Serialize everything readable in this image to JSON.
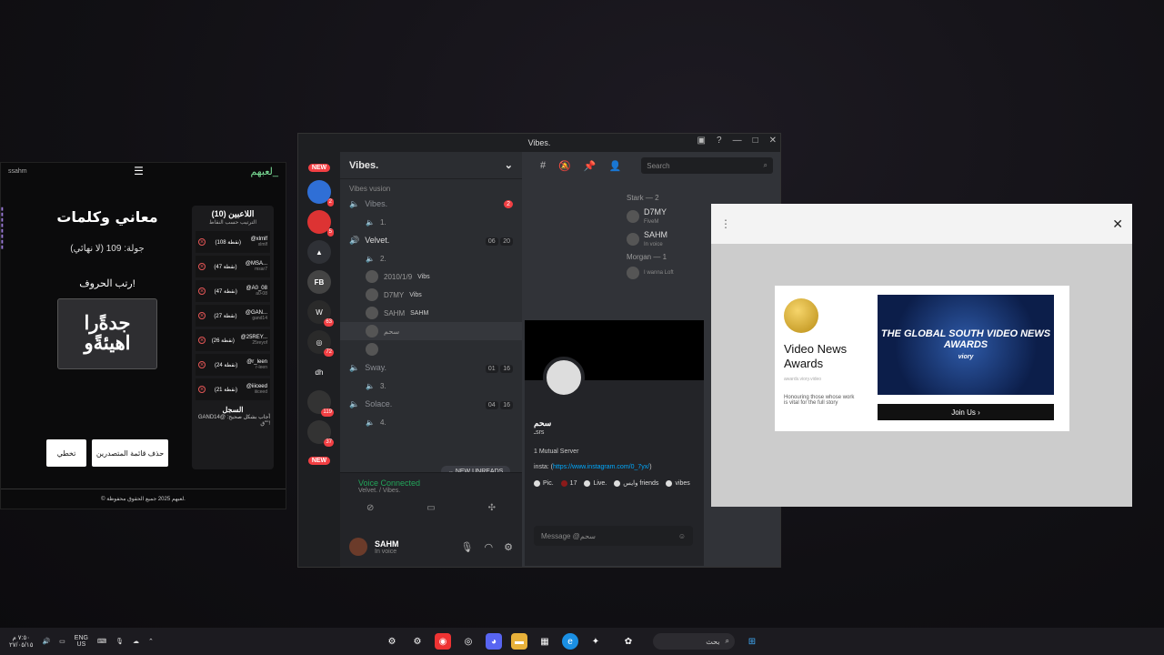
{
  "game": {
    "user": "ssahm",
    "logo": "لعبهم_",
    "title": "معاني وكلمات",
    "round": "جولة: 109 (لا نهائي)",
    "arrange": "رتب الحروف!",
    "letters": "جدةًرا اهيئةًو",
    "skip_button": "تخطي",
    "delete_button": "حذف قائمة المتصدرين",
    "footer": "© لعبهم 2025 جميع الحقوق محفوظة.",
    "players_title": "اللاعبين (10)",
    "players_sub": "الترتيب حسب النقاط",
    "players": [
      {
        "name": "@xlmlf",
        "pts": "(108 نقطة)",
        "sub": "xlmlf"
      },
      {
        "name": "@MSA...",
        "pts": "(47 نقطة)",
        "sub": "msar7"
      },
      {
        "name": "@A0_08",
        "pts": "(47 نقطة)",
        "sub": "a0-08"
      },
      {
        "name": "@GAN...",
        "pts": "(27 نقطة)",
        "sub": "gand14"
      },
      {
        "name": "@25REY...",
        "pts": "(26 نقطة)",
        "sub": "25reyof"
      },
      {
        "name": "@r_leen",
        "pts": "(24 نقطة)",
        "sub": "r-leen"
      },
      {
        "name": "@iiiceed",
        "pts": "(21 نقطة)",
        "sub": "iiiceed"
      }
    ],
    "log_title": "السجل",
    "log_text": "GAND14@ أجاب بشكل صحيح: \"ق\"!"
  },
  "discord": {
    "window_title": "Vibes.",
    "guild_name": "Vibes.",
    "category": "Vibes vusion",
    "channels": [
      {
        "name": "Vibes.",
        "count_a": "",
        "count_b": "2"
      },
      {
        "name": "Velvet.",
        "count_a": "06",
        "count_b": "20"
      },
      {
        "name": "Sway.",
        "count_a": "01",
        "count_b": "16"
      },
      {
        "name": "Solace.",
        "count_a": "04",
        "count_b": "16"
      }
    ],
    "sub_items": [
      "1.",
      "2.",
      "3.",
      "4."
    ],
    "members": [
      {
        "name": "2010/1/9",
        "tag": "Vibs"
      },
      {
        "name": "D7MY",
        "tag": "Vibs"
      },
      {
        "name": "SAHM",
        "tag": "SAHM"
      }
    ],
    "new_unreads": "NEW UNREADS",
    "voice_status": "Voice Connected",
    "voice_channel": "Velvet. / Vibes.",
    "user_name": "SAHM",
    "user_status": "In voice",
    "search_placeholder": "Search",
    "member_groups": [
      {
        "title": "Stark — 2",
        "rows": [
          {
            "name": "D7MY",
            "activity": "FiveM"
          },
          {
            "name": "SAHM",
            "activity": "In voice"
          }
        ]
      },
      {
        "title": "Morgan — 1",
        "rows": [
          {
            "name": "",
            "activity": "I wanna Loft"
          }
        ]
      }
    ],
    "profile": {
      "name": "سحم",
      "subname": "ـsrs",
      "mutual": "1 Mutual Server",
      "insta_label": "insta: (",
      "insta_link": "https://www.instagram.com/0_7yx/",
      "insta_close": ")",
      "pills": [
        "Pic.",
        "17",
        "Live.",
        "وايس friends",
        "vibes"
      ],
      "message_placeholder": "Message @سحم"
    },
    "servers": [
      "NEW",
      "dh",
      "NEW"
    ]
  },
  "ad": {
    "title": "Video News Awards",
    "url": "awards.viory.video",
    "description": "Honouring those whose work is vital for the full story",
    "image_text": "THE GLOBAL SOUTH VIDEO NEWS AWARDS",
    "image_brand": "viory",
    "join_button": "Join Us"
  },
  "taskbar": {
    "time": "٧:٥٠ م",
    "date": "٢٧/٠٥/١٥",
    "lang": "ENG",
    "region": "US",
    "search_text": "بحث"
  }
}
